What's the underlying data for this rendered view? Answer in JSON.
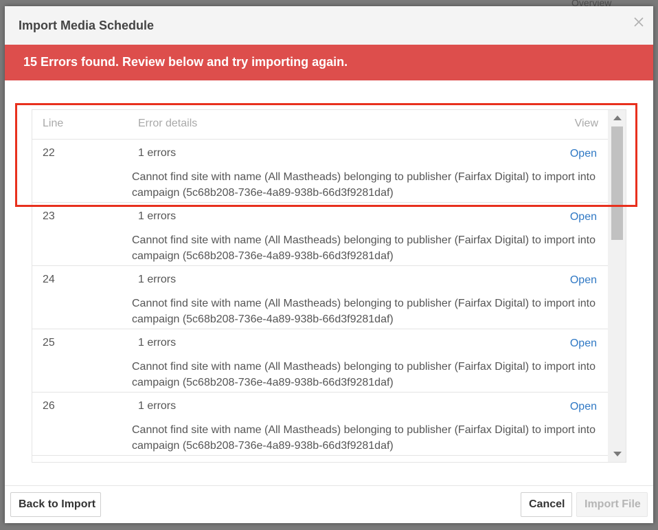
{
  "background": {
    "overview_label": "Overview"
  },
  "dialog": {
    "title": "Import Media Schedule",
    "close_icon": "close-icon",
    "error_banner": "15 Errors found. Review below and try importing again.",
    "colors": {
      "banner": "#dd4e4c",
      "link": "#2f78c4",
      "highlight": "#e8301d"
    }
  },
  "table": {
    "headers": {
      "line": "Line",
      "details": "Error details",
      "view": "View"
    },
    "rows": [
      {
        "line": "22",
        "count": "1 errors",
        "action": "Open",
        "message": "Cannot find site with name (All Mastheads) belonging to publisher (Fairfax Digital) to import into campaign (5c68b208-736e-4a89-938b-66d3f9281daf)"
      },
      {
        "line": "23",
        "count": "1 errors",
        "action": "Open",
        "message": "Cannot find site with name (All Mastheads) belonging to publisher (Fairfax Digital) to import into campaign (5c68b208-736e-4a89-938b-66d3f9281daf)"
      },
      {
        "line": "24",
        "count": "1 errors",
        "action": "Open",
        "message": "Cannot find site with name (All Mastheads) belonging to publisher (Fairfax Digital) to import into campaign (5c68b208-736e-4a89-938b-66d3f9281daf)"
      },
      {
        "line": "25",
        "count": "1 errors",
        "action": "Open",
        "message": "Cannot find site with name (All Mastheads) belonging to publisher (Fairfax Digital) to import into campaign (5c68b208-736e-4a89-938b-66d3f9281daf)"
      },
      {
        "line": "26",
        "count": "1 errors",
        "action": "Open",
        "message": "Cannot find site with name (All Mastheads) belonging to publisher (Fairfax Digital) to import into campaign (5c68b208-736e-4a89-938b-66d3f9281daf)"
      }
    ]
  },
  "footer": {
    "back_label": "Back to Import",
    "cancel_label": "Cancel",
    "import_label": "Import File"
  }
}
